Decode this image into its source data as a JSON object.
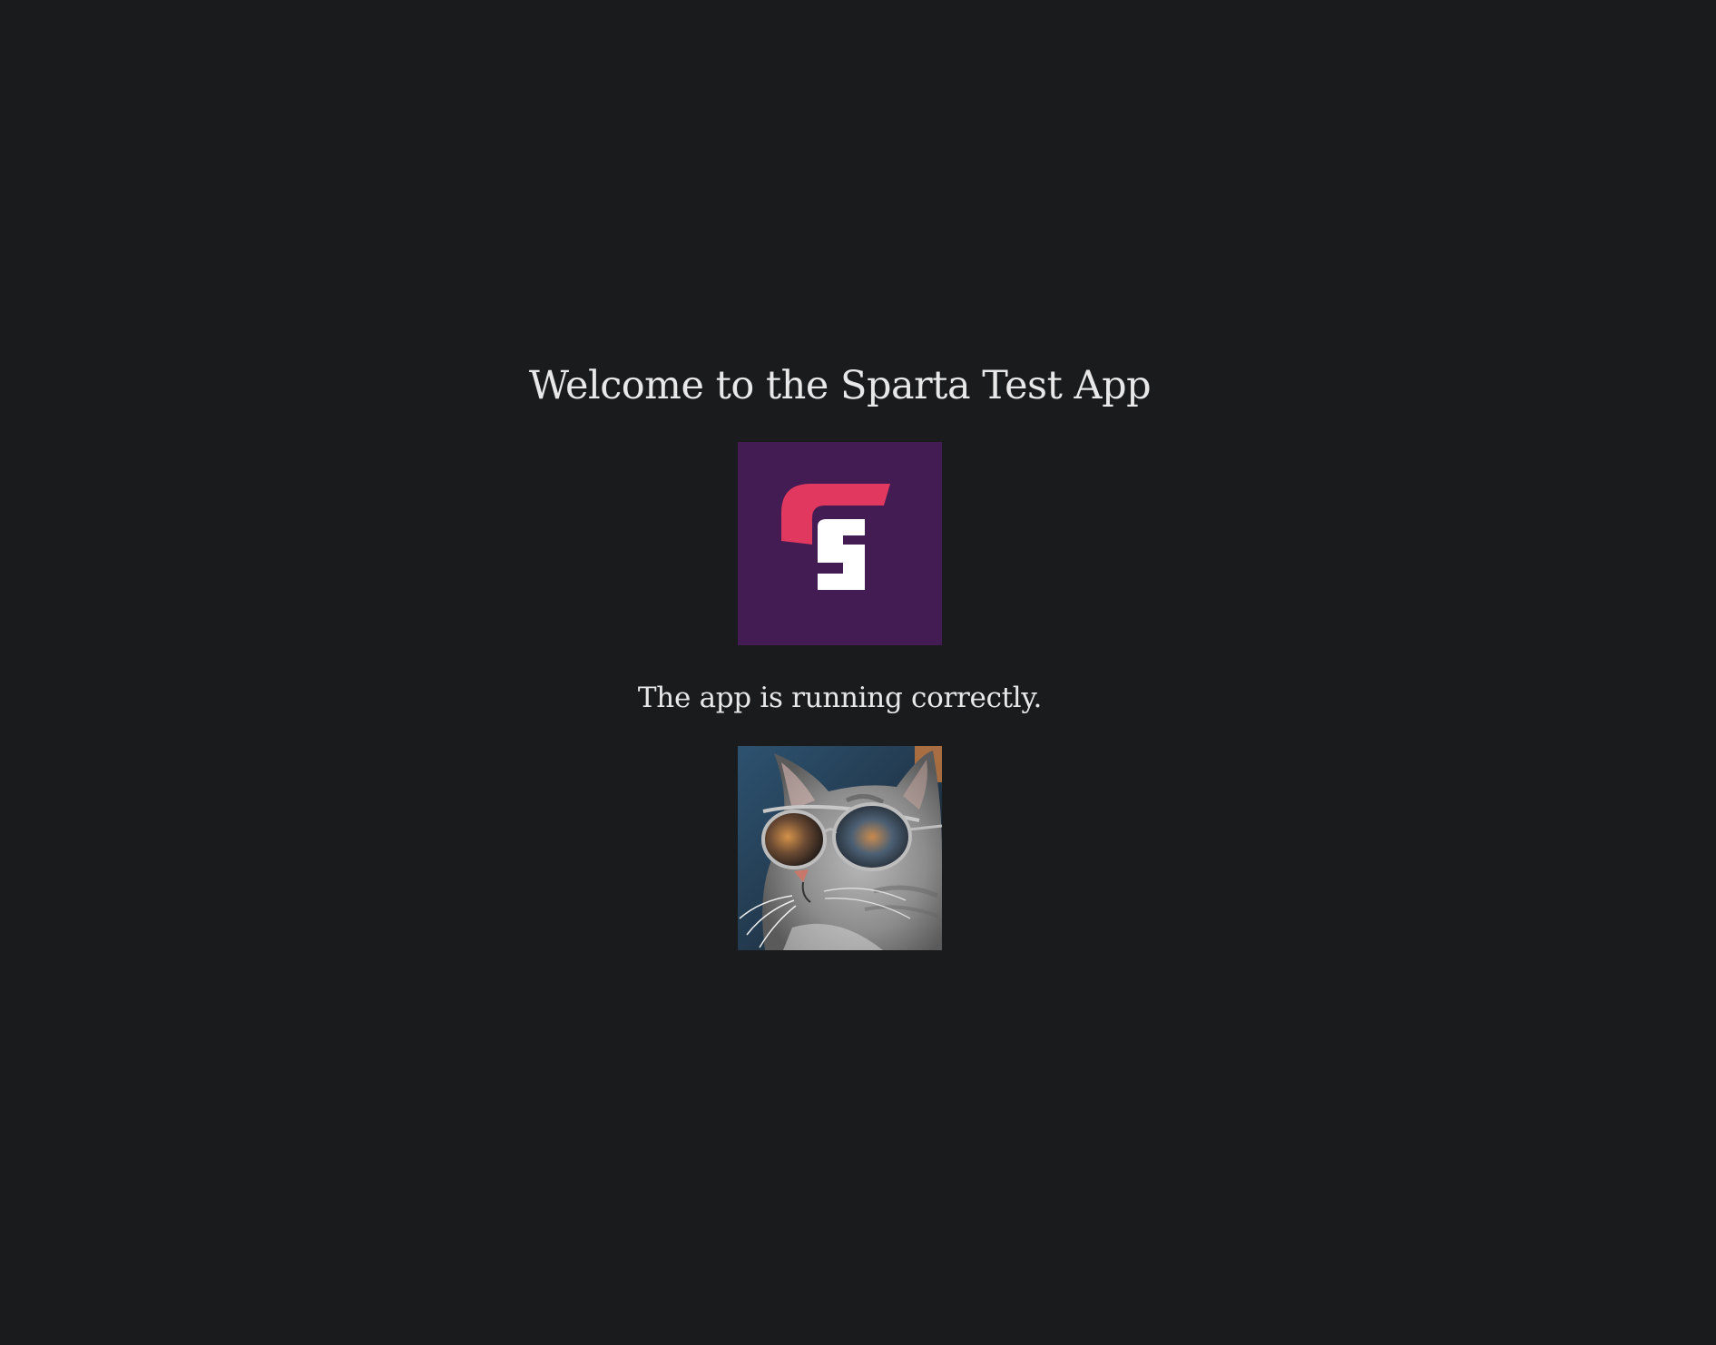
{
  "page": {
    "title": "Welcome to the Sparta Test App",
    "status_message": "The app is running correctly."
  },
  "images": {
    "logo": {
      "icon": "sparta-logo-icon",
      "background_color": "#421c52",
      "accent_color": "#e0385f",
      "letter": "S"
    },
    "photo": {
      "icon": "cat-with-sunglasses-image"
    }
  },
  "colors": {
    "background": "#1a1b1d",
    "text": "#e8e8e8"
  }
}
